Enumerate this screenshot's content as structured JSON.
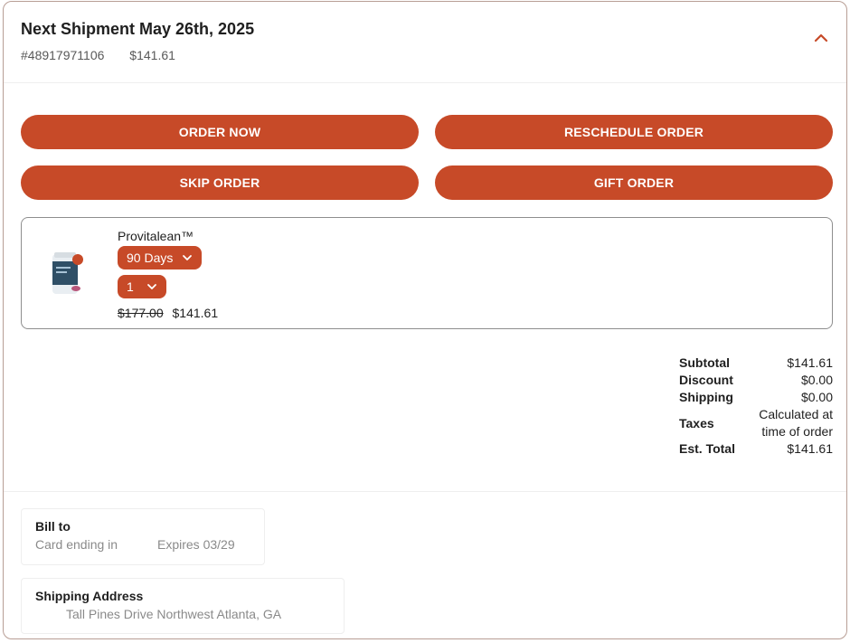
{
  "shipment": {
    "title": "Next Shipment May 26th, 2025",
    "order_number": "#48917971106",
    "amount": "$141.61"
  },
  "actions": {
    "order_now": "ORDER NOW",
    "reschedule": "RESCHEDULE ORDER",
    "skip": "SKIP ORDER",
    "gift": "GIFT ORDER"
  },
  "product": {
    "name": "Provitalean™",
    "frequency": "90 Days",
    "quantity": "1",
    "original_price": "$177.00",
    "price": "$141.61"
  },
  "totals": {
    "subtotal_label": "Subtotal",
    "subtotal": "$141.61",
    "discount_label": "Discount",
    "discount": "$0.00",
    "shipping_label": "Shipping",
    "shipping": "$0.00",
    "taxes_label": "Taxes",
    "taxes": "Calculated at time of order",
    "est_total_label": "Est. Total",
    "est_total": "$141.61"
  },
  "billing": {
    "title": "Bill to",
    "card": "Card ending in",
    "expires": "Expires 03/29"
  },
  "shipping_address": {
    "title": "Shipping Address",
    "address": "Tall Pines Drive Northwest Atlanta, GA"
  },
  "colors": {
    "accent": "#c74a28",
    "border": "#b89e95"
  }
}
